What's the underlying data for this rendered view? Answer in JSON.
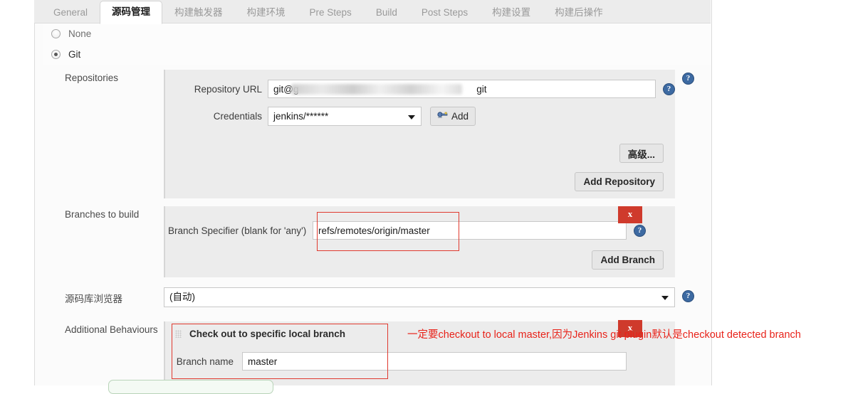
{
  "tabs": [
    {
      "label": "General",
      "active": false
    },
    {
      "label": "源码管理",
      "active": true
    },
    {
      "label": "构建触发器",
      "active": false
    },
    {
      "label": "构建环境",
      "active": false
    },
    {
      "label": "Pre Steps",
      "active": false
    },
    {
      "label": "Build",
      "active": false
    },
    {
      "label": "Post Steps",
      "active": false
    },
    {
      "label": "构建设置",
      "active": false
    },
    {
      "label": "构建后操作",
      "active": false
    }
  ],
  "scm": {
    "options": [
      {
        "label": "None",
        "selected": false
      },
      {
        "label": "Git",
        "selected": true
      }
    ]
  },
  "repositories": {
    "section_label": "Repositories",
    "repository_url_label": "Repository URL",
    "repository_url_prefix": "git@g",
    "repository_url_suffix": "git",
    "credentials_label": "Credentials",
    "credentials_value": "jenkins/******",
    "add_credentials_label": "Add",
    "advanced_label": "高级...",
    "add_repository_label": "Add Repository"
  },
  "branches": {
    "section_label": "Branches to build",
    "branch_specifier_label": "Branch Specifier (blank for 'any')",
    "branch_specifier_value": "refs/remotes/origin/master",
    "add_branch_label": "Add Branch"
  },
  "repo_browser": {
    "section_label": "源码库浏览器",
    "value": "(自动)"
  },
  "additional_behaviours": {
    "section_label": "Additional Behaviours",
    "behaviour_title": "Check out to specific local branch",
    "branch_name_label": "Branch name",
    "branch_name_value": "master"
  },
  "annotations": {
    "x_label_1": "x",
    "x_label_2": "x",
    "note": "一定要checkout to local master,因为Jenkins git plugin默认是checkout detected branch",
    "accent_color": "#e8231a",
    "box_color": "#e03a2f",
    "x_button_color": "#cf3a2c"
  },
  "help_icon": {
    "glyph": "?"
  }
}
